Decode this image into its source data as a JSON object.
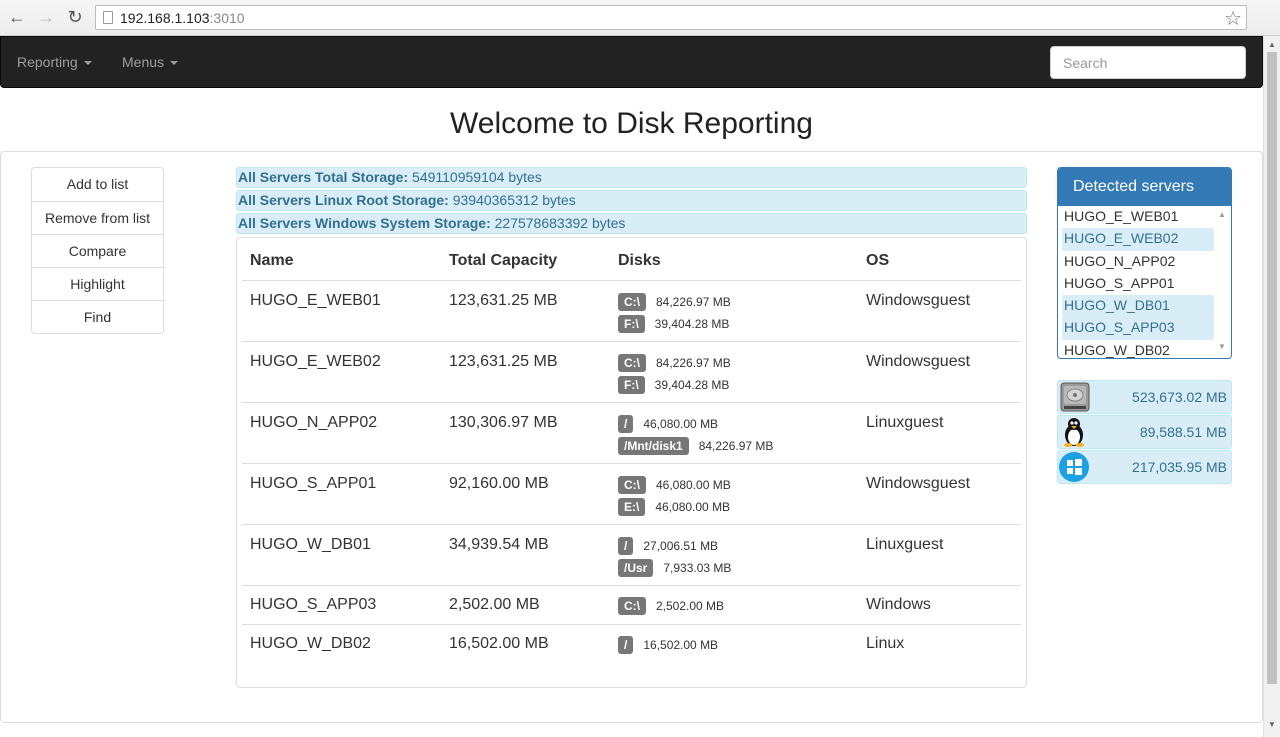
{
  "browser": {
    "url_host": "192.168.1.103",
    "url_port": ":3010"
  },
  "navbar": {
    "menus": [
      "Reporting",
      "Menus"
    ],
    "search_placeholder": "Search"
  },
  "page": {
    "title": "Welcome to Disk Reporting"
  },
  "actions": [
    "Add to list",
    "Remove from list",
    "Compare",
    "Highlight",
    "Find"
  ],
  "summary": [
    {
      "label": "All Servers Total Storage:",
      "value": "549110959104 bytes"
    },
    {
      "label": "All Servers Linux Root Storage:",
      "value": "93940365312 bytes"
    },
    {
      "label": "All Servers Windows System Storage:",
      "value": "227578683392 bytes"
    }
  ],
  "table": {
    "headers": [
      "Name",
      "Total Capacity",
      "Disks",
      "OS"
    ],
    "rows": [
      {
        "name": "HUGO_E_WEB01",
        "capacity": "123,631.25 MB",
        "os": "Windowsguest",
        "disks": [
          {
            "label": "C:\\",
            "size": "84,226.97 MB"
          },
          {
            "label": "F:\\",
            "size": "39,404.28 MB"
          }
        ]
      },
      {
        "name": "HUGO_E_WEB02",
        "capacity": "123,631.25 MB",
        "os": "Windowsguest",
        "disks": [
          {
            "label": "C:\\",
            "size": "84,226.97 MB"
          },
          {
            "label": "F:\\",
            "size": "39,404.28 MB"
          }
        ]
      },
      {
        "name": "HUGO_N_APP02",
        "capacity": "130,306.97 MB",
        "os": "Linuxguest",
        "disks": [
          {
            "label": "/",
            "size": "46,080.00 MB"
          },
          {
            "label": "/Mnt/disk1",
            "size": "84,226.97 MB"
          }
        ]
      },
      {
        "name": "HUGO_S_APP01",
        "capacity": "92,160.00 MB",
        "os": "Windowsguest",
        "disks": [
          {
            "label": "C:\\",
            "size": "46,080.00 MB"
          },
          {
            "label": "E:\\",
            "size": "46,080.00 MB"
          }
        ]
      },
      {
        "name": "HUGO_W_DB01",
        "capacity": "34,939.54 MB",
        "os": "Linuxguest",
        "disks": [
          {
            "label": "/",
            "size": "27,006.51 MB"
          },
          {
            "label": "/Usr",
            "size": "7,933.03 MB"
          }
        ]
      },
      {
        "name": "HUGO_S_APP03",
        "capacity": "2,502.00 MB",
        "os": "Windows",
        "disks": [
          {
            "label": "C:\\",
            "size": "2,502.00 MB"
          }
        ]
      },
      {
        "name": "HUGO_W_DB02",
        "capacity": "16,502.00 MB",
        "os": "Linux",
        "disks": [
          {
            "label": "/",
            "size": "16,502.00 MB"
          }
        ]
      }
    ]
  },
  "detected": {
    "title": "Detected servers",
    "servers": [
      {
        "name": "HUGO_E_WEB01",
        "selected": false
      },
      {
        "name": "HUGO_E_WEB02",
        "selected": true
      },
      {
        "name": "HUGO_N_APP02",
        "selected": false
      },
      {
        "name": "HUGO_S_APP01",
        "selected": false
      },
      {
        "name": "HUGO_W_DB01",
        "selected": true
      },
      {
        "name": "HUGO_S_APP03",
        "selected": true
      },
      {
        "name": "HUGO_W_DB02",
        "selected": false
      }
    ]
  },
  "os_totals": [
    {
      "icon": "hard-disk-icon",
      "value": "523,673.02 MB"
    },
    {
      "icon": "linux-penguin-icon",
      "value": "89,588.51 MB"
    },
    {
      "icon": "windows-icon",
      "value": "217,035.95 MB"
    }
  ],
  "colors": {
    "navbar_bg": "#222222",
    "info_bg": "#d9edf7",
    "info_text": "#31708f",
    "primary": "#337ab7",
    "label_bg": "#777777"
  }
}
